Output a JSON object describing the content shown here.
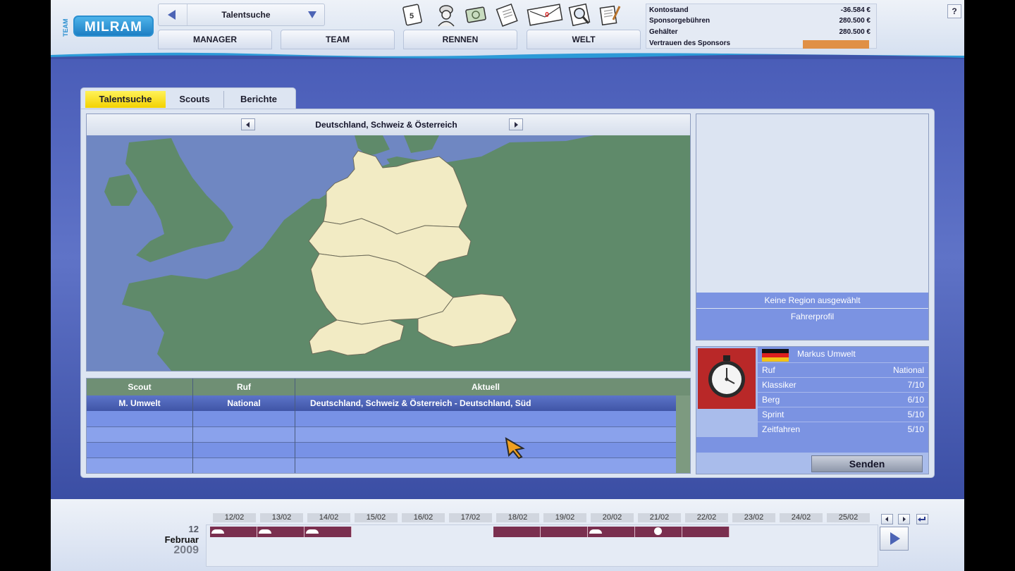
{
  "logo": {
    "team": "TEAM",
    "brand": "MILRAM"
  },
  "nav": {
    "current": "Talentsuche"
  },
  "main_tabs": [
    "MANAGER",
    "TEAM",
    "RENNEN",
    "WELT"
  ],
  "toolbar_icons": [
    "calendar-icon",
    "rider-icon",
    "money-icon",
    "contract-icon",
    "mail-icon",
    "search-icon",
    "notepad-icon"
  ],
  "mail_count": "0",
  "finance": [
    {
      "label": "Kontostand",
      "value": "-36.584 €"
    },
    {
      "label": "Sponsorgebühren",
      "value": "280.500 €"
    },
    {
      "label": "Gehälter",
      "value": "280.500 €"
    },
    {
      "label": "Vertrauen des Sponsors",
      "value": ""
    }
  ],
  "sponsor_trust_color": "#e09046",
  "help_label": "?",
  "panel_tabs": [
    {
      "label": "Talentsuche",
      "active": true
    },
    {
      "label": "Scouts",
      "active": false
    },
    {
      "label": "Berichte",
      "active": false
    }
  ],
  "region": {
    "name": "Deutschland, Schweiz & Österreich"
  },
  "scout_table": {
    "headers": [
      "Scout",
      "Ruf",
      "Aktuell"
    ],
    "rows": [
      {
        "scout": "M. Umwelt",
        "ruf": "National",
        "aktuell": "Deutschland, Schweiz & Österreich - Deutschland, Süd"
      }
    ]
  },
  "info": {
    "no_region": "Keine Region ausgewählt",
    "profile": "Fahrerprofil"
  },
  "rider": {
    "name": "Markus Umwelt",
    "stats": [
      {
        "label": "Ruf",
        "value": "National"
      },
      {
        "label": "Klassiker",
        "value": "7/10"
      },
      {
        "label": "Berg",
        "value": "6/10"
      },
      {
        "label": "Sprint",
        "value": "5/10"
      },
      {
        "label": "Zeitfahren",
        "value": "5/10"
      }
    ]
  },
  "send_label": "Senden",
  "date": {
    "day": "12",
    "month": "Februar",
    "year": "2009"
  },
  "timeline_dates": [
    "12/02",
    "13/02",
    "14/02",
    "15/02",
    "16/02",
    "17/02",
    "18/02",
    "19/02",
    "20/02",
    "21/02",
    "22/02",
    "23/02",
    "24/02",
    "25/02"
  ]
}
